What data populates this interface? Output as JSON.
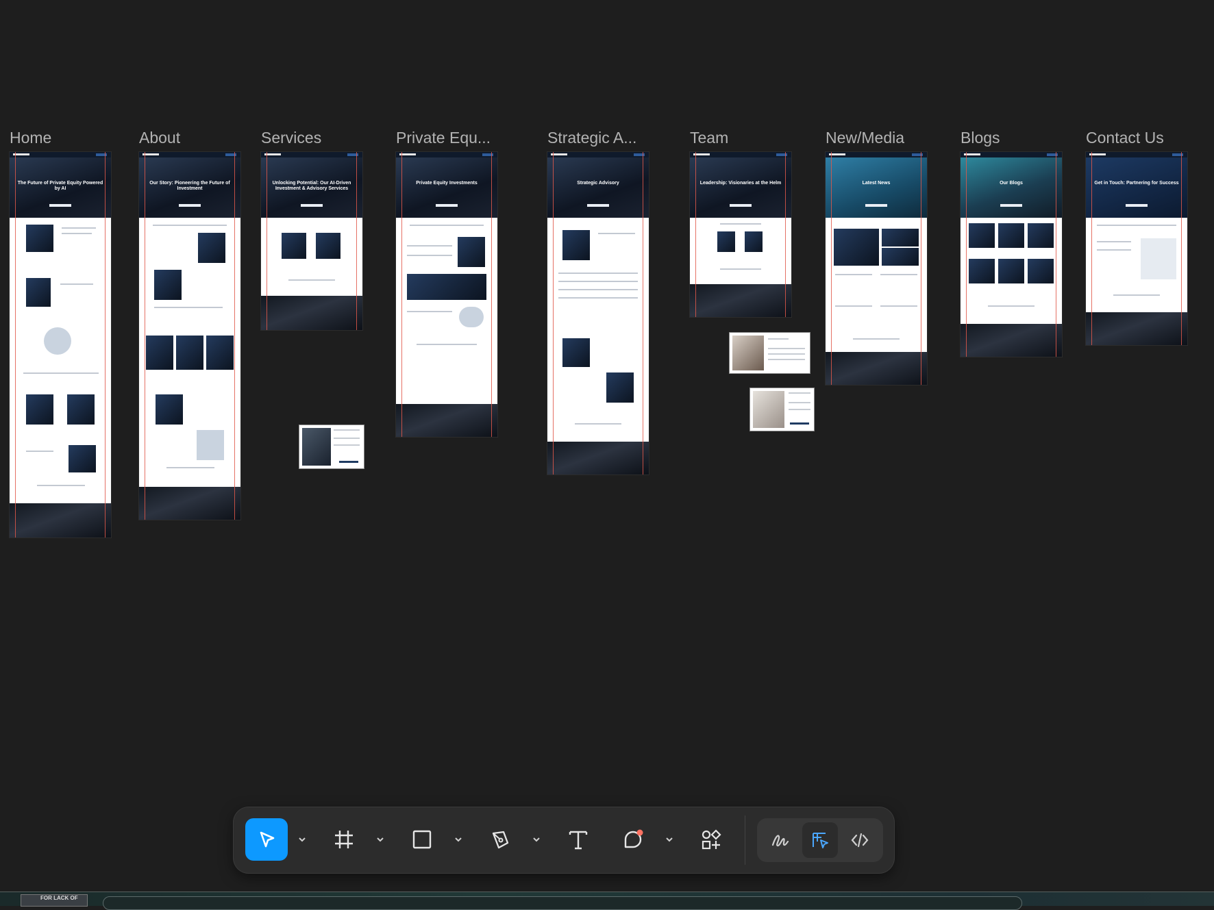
{
  "canvas": {
    "frames": [
      {
        "id": "home",
        "label": "Home"
      },
      {
        "id": "about",
        "label": "About"
      },
      {
        "id": "services",
        "label": "Services"
      },
      {
        "id": "private-equity",
        "label": "Private Equ..."
      },
      {
        "id": "strategic-advisory",
        "label": "Strategic A..."
      },
      {
        "id": "team",
        "label": "Team"
      },
      {
        "id": "news-media",
        "label": "New/Media"
      },
      {
        "id": "blogs",
        "label": "Blogs"
      },
      {
        "id": "contact-us",
        "label": "Contact Us"
      }
    ],
    "hero_titles": {
      "home": "The Future of Private Equity Powered by AI",
      "about": "Our Story: Pioneering the Future of Investment",
      "services": "Unlocking Potential: Our AI-Driven Investment & Advisory Services",
      "private_equity": "Private Equity Investments",
      "strategic_advisory": "Strategic Advisory",
      "team": "Leadership: Visionaries at the Helm",
      "news_media": "Latest News",
      "blogs": "Our Blogs",
      "contact_us": "Get in Touch: Partnering for Success"
    }
  },
  "toolbar": {
    "tools": [
      {
        "name": "move-tool",
        "icon": "cursor-arrow-icon",
        "active": true,
        "has_menu": true
      },
      {
        "name": "frame-tool",
        "icon": "frame-hash-icon",
        "active": false,
        "has_menu": true
      },
      {
        "name": "shape-tool",
        "icon": "rectangle-icon",
        "active": false,
        "has_menu": true
      },
      {
        "name": "pen-tool",
        "icon": "pen-nib-icon",
        "active": false,
        "has_menu": true
      },
      {
        "name": "text-tool",
        "icon": "text-T-icon",
        "active": false,
        "has_menu": false
      },
      {
        "name": "comment-tool",
        "icon": "comment-bubble-icon",
        "active": false,
        "has_menu": true
      },
      {
        "name": "actions-tool",
        "icon": "shapes-plus-icon",
        "active": false,
        "has_menu": false
      }
    ],
    "modes": [
      {
        "name": "draw-mode",
        "icon": "squiggle-icon",
        "active": false
      },
      {
        "name": "design-mode",
        "icon": "design-cursor-icon",
        "active": true
      },
      {
        "name": "dev-mode",
        "icon": "code-brackets-icon",
        "active": false
      }
    ],
    "accent_color": "#0d99ff",
    "notification_color": "#ff7262"
  },
  "taskbar": {
    "thumbnail_text": "FOR LACK OF"
  }
}
